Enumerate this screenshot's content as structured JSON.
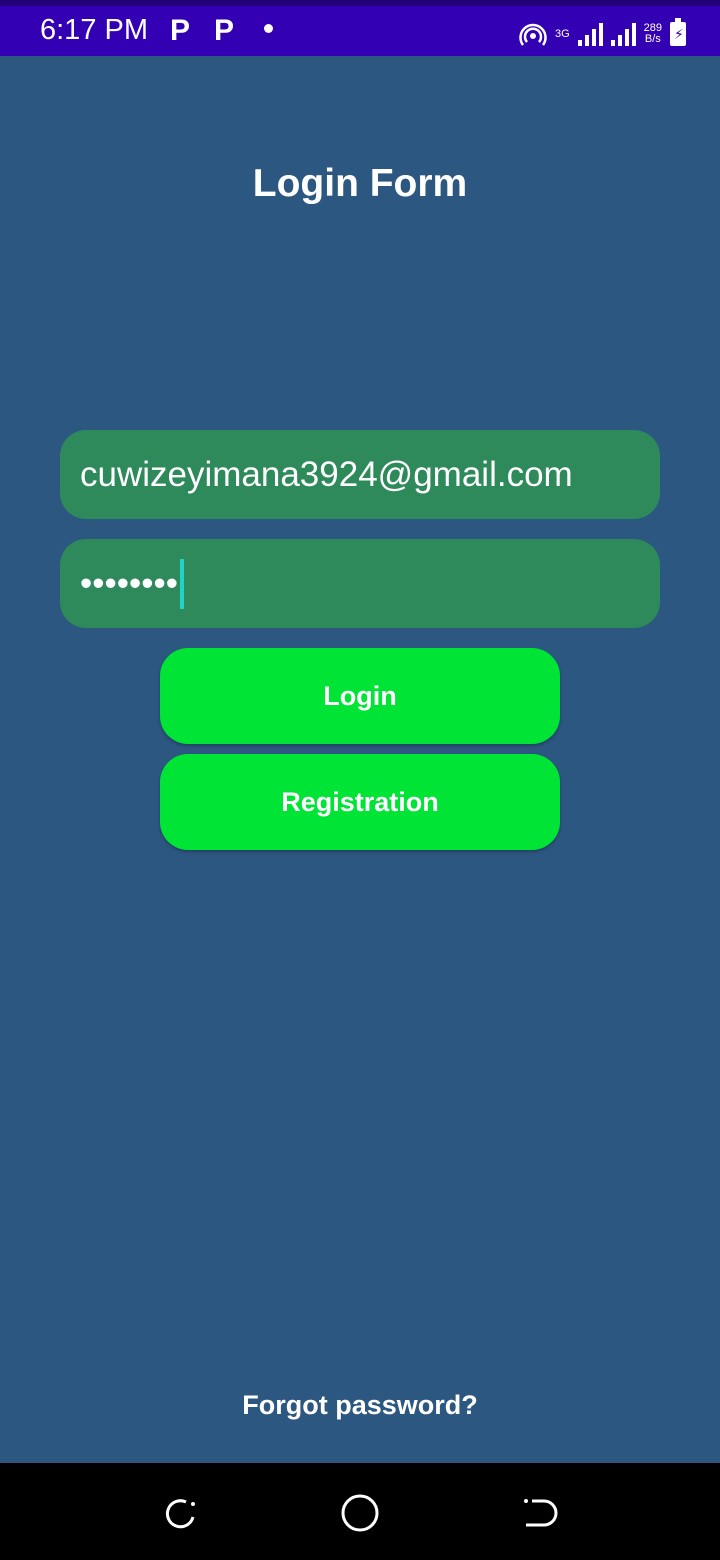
{
  "status_bar": {
    "time": "6:17 PM",
    "app_icons": [
      "P",
      "P"
    ],
    "network_type": "3G",
    "speed_value": "289",
    "speed_unit": "B/s",
    "icons": [
      "hotspot-icon",
      "signal-icon",
      "battery-charging-icon"
    ]
  },
  "form": {
    "title": "Login Form",
    "email_value": "cuwizeyimana3924@gmail.com",
    "password_value": "••••••••",
    "login_label": "Login",
    "registration_label": "Registration",
    "forgot_label": "Forgot password?"
  },
  "colors": {
    "background": "#2c5780",
    "status_bar": "#3300b3",
    "field": "#2e8a5a",
    "button": "#00e436",
    "cursor": "#1fd3c6"
  },
  "nav_bar": {
    "icons": [
      "recent-apps-icon",
      "home-icon",
      "back-icon"
    ]
  }
}
